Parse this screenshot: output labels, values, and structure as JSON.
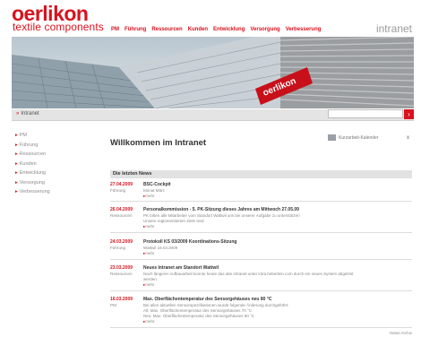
{
  "brand": {
    "logo_top": "oerlikon",
    "logo_bottom": "textile components",
    "accent": "#d8121d"
  },
  "topnav": [
    "PM",
    "Führung",
    "Ressourcen",
    "Kunden",
    "Entwicklung",
    "Versorgung",
    "Verbesserung"
  ],
  "header_right": "intranet",
  "banner": {
    "sign_text": "oerlikon"
  },
  "breadcrumb": {
    "label": "Intranet"
  },
  "search": {
    "placeholder": "",
    "button_glyph": "›"
  },
  "leftnav": [
    "PM",
    "Führung",
    "Ressourcen",
    "Kunden",
    "Entwicklung",
    "Versorgung",
    "Verbesserung"
  ],
  "main": {
    "title": "Willkommen im Intranet",
    "calendar_label": "Kurzarbeit-Kalender",
    "calendar_close": "x"
  },
  "news": {
    "heading": "Die letzten News",
    "items": [
      {
        "date": "27.04.2009",
        "category": "Führung",
        "title": "BSC-Cockpit",
        "lines": [
          "Monat März"
        ],
        "more": "mehr"
      },
      {
        "date": "26.04.2009",
        "category": "Ressourcen",
        "title": "Personalkommission - 5. PK-Sitzung dieses Jahres am Mittwoch 27.05.09",
        "lines": [
          "PK bitten alle Mitarbeiter vom Standort Wattwil uns bei unserer Aufgabe zu unterstützen",
          "Unsere reglementierten Ziele sind"
        ],
        "more": "mehr"
      },
      {
        "date": "24.03.2009",
        "category": "Führung",
        "title": "Protokoll KS 03/2009 Koordinations-Sitzung",
        "lines": [
          "Wattwil 18.03.2009"
        ],
        "more": "mehr"
      },
      {
        "date": "23.03.2009",
        "category": "Ressourcen",
        "title": "Neues Intranet am Standort Wattwil",
        "lines": [
          "Nach längerer Aufbauarbeit konnte heute das alte Intranet unter intra.heberlein.com durch ein neues System abgelöst",
          "werden."
        ],
        "more": "mehr"
      },
      {
        "date": "16.03.2009",
        "category": "PM",
        "title": "Max. Oberflächentemperatur des Sensorgehäuses neu 80 °C",
        "lines": [
          "Bei allen aktuellen Sensorspezifikationen wurde folgende Änderung durchgeführt:",
          "Alt: Max. Oberflächentemperatur des Sensorgehäuses 70 °C",
          "Neu: Max. Oberflächentemperatur des Sensorgehäuses 80 °C"
        ],
        "more": "mehr"
      }
    ],
    "archive_link": "News Archiv"
  }
}
